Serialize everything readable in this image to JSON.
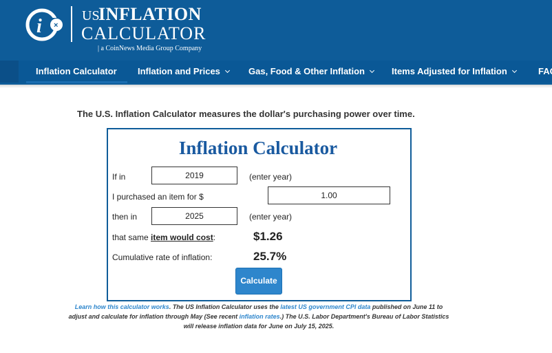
{
  "brand": {
    "us": "US",
    "inflation": "INFLATION",
    "calculator": "CALCULATOR",
    "tagline": "| a CoinNews Media Group Company",
    "colors": {
      "header": "#0e5c99",
      "accent": "#2e86cc",
      "title": "#1a5aa0"
    }
  },
  "nav": {
    "items": [
      {
        "label": "Inflation Calculator"
      },
      {
        "label": "Inflation and Prices"
      },
      {
        "label": "Gas, Food & Other Inflation"
      },
      {
        "label": "Items Adjusted for Inflation"
      },
      {
        "label": "FAQ"
      }
    ]
  },
  "intro": "The U.S. Inflation Calculator measures the dollar's purchasing power over time.",
  "calculator": {
    "title": "Inflation Calculator",
    "if_in_label": "If in",
    "year_from": "2019",
    "enter_year_1": "(enter year)",
    "purchased_label": "I purchased an item for $",
    "amount": "1.00",
    "then_in_label": "then in",
    "year_to": "2025",
    "enter_year_2": "(enter year)",
    "cost_label_prefix": "that same ",
    "cost_label_emph": "item would cost",
    "cost_label_suffix": ":",
    "cost_value": "$1.26",
    "rate_label": "Cumulative rate of inflation:",
    "rate_value": "25.7%",
    "button": "Calculate"
  },
  "footer": {
    "link1": "Learn how this calculator works",
    "text1": ". The US Inflation Calculator uses the ",
    "link2": "latest US government CPI data",
    "text2": " published on June 11 to",
    "text3": "adjust and calculate for inflation through May (See recent ",
    "link3": "inflation rates",
    "text4": ".) The U.S. Labor Department's Bureau of Labor Statistics",
    "text5": "will release inflation data for June on July 15, 2025."
  }
}
